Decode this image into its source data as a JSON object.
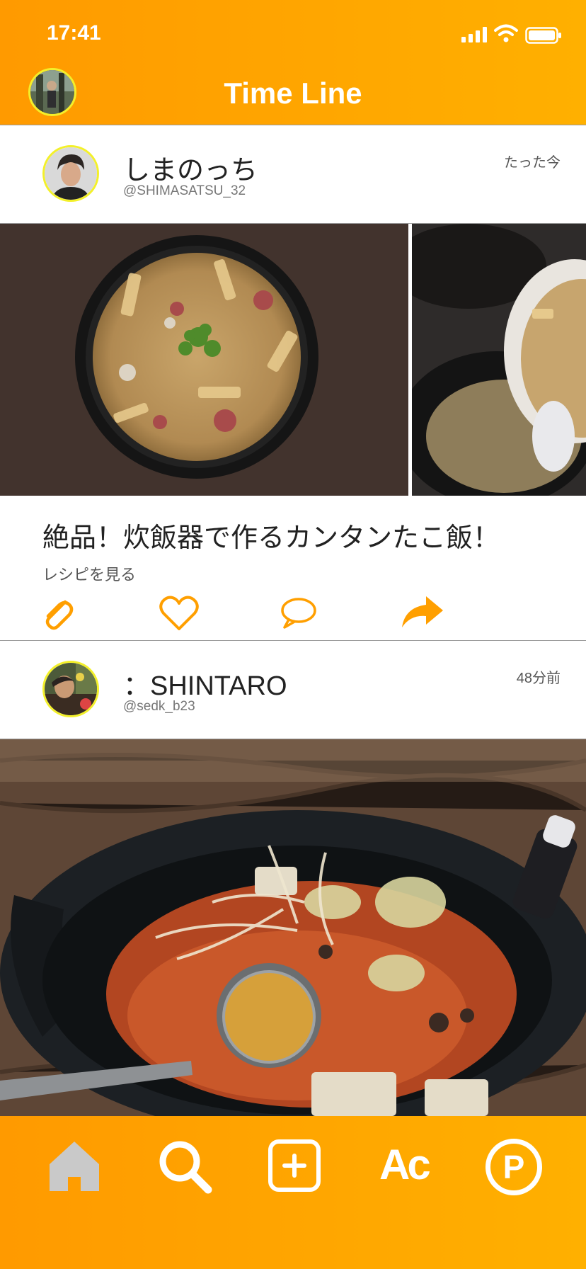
{
  "status": {
    "time": "17:41"
  },
  "header": {
    "title": "Time Line"
  },
  "posts": [
    {
      "user_name": "しまのっち",
      "handle": "@SHIMASATSU_32",
      "time_ago": "たった今",
      "title": "絶品！炊飯器で作るカンタンたこ飯！",
      "link_label": "レシピを見る"
    },
    {
      "user_name": "：SHINTARO",
      "handle": "@sedk_b23",
      "time_ago": "48分前"
    }
  ],
  "actions": [
    "clip-icon",
    "heart-icon",
    "comment-icon",
    "share-icon"
  ],
  "tabbar": {
    "items": [
      "home-icon",
      "search-icon",
      "add-post-icon",
      "account-icon",
      "points-icon"
    ],
    "ac_label": "Ac",
    "p_label": "P"
  },
  "colors": {
    "brand": "#ff9f00",
    "avatar_ring": "#f3f02a",
    "inactive_tab": "#c9c9c9"
  }
}
